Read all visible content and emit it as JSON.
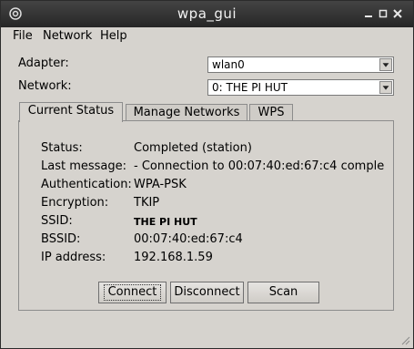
{
  "window": {
    "title": "wpa_gui"
  },
  "menu": {
    "file": "File",
    "network": "Network",
    "help": "Help"
  },
  "adapter": {
    "label": "Adapter:",
    "value": "wlan0"
  },
  "network": {
    "label": "Network:",
    "value": "0:  THE PI HUT"
  },
  "tabs": [
    "Current Status",
    "Manage Networks",
    "WPS"
  ],
  "status": {
    "status_label": "Status:",
    "status_value": "Completed (station)",
    "last_label": "Last message:",
    "last_value": "- Connection to 00:07:40:ed:67:c4 comple",
    "auth_label": "Authentication:",
    "auth_value": "WPA-PSK",
    "enc_label": "Encryption:",
    "enc_value": "TKIP",
    "ssid_label": "SSID:",
    "ssid_value": "THE PI HUT",
    "bssid_label": "BSSID:",
    "bssid_value": "00:07:40:ed:67:c4",
    "ip_label": "IP address:",
    "ip_value": "192.168.1.59"
  },
  "buttons": {
    "connect": "Connect",
    "disconnect": "Disconnect",
    "scan": "Scan"
  }
}
